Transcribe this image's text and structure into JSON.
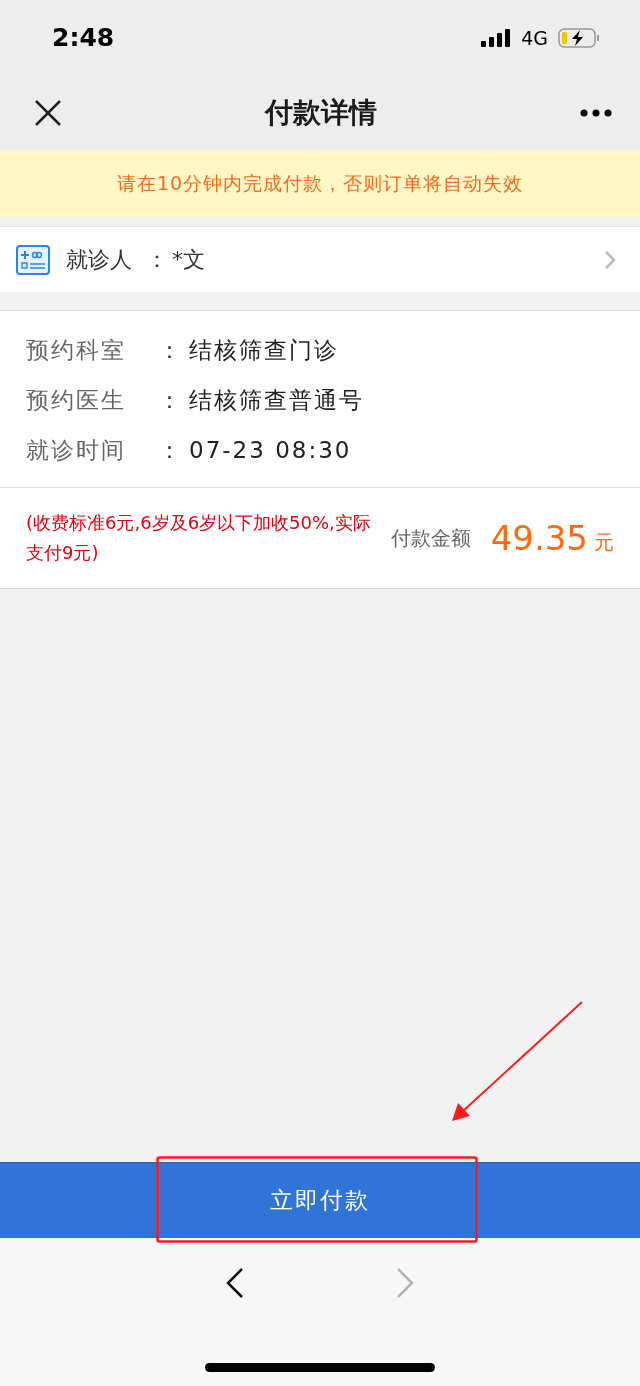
{
  "status_bar": {
    "time": "2:48",
    "network": "4G"
  },
  "nav": {
    "title": "付款详情"
  },
  "notice": "请在10分钟内完成付款，否则订单将自动失效",
  "patient": {
    "label": "就诊人",
    "separator": "：",
    "value": "*文"
  },
  "details": [
    {
      "label": "预约科室",
      "separator": "：",
      "value": "结核筛查门诊"
    },
    {
      "label": "预约医生",
      "separator": "：",
      "value": "结核筛查普通号"
    },
    {
      "label": "就诊时间",
      "separator": "：",
      "value": "07-23 08:30"
    }
  ],
  "fee": {
    "note": "(收费标准6元,6岁及6岁以下加收50%,实际支付9元)",
    "amount_label": "付款金额",
    "amount": "49.35",
    "unit": "元"
  },
  "pay_button": "立即付款",
  "browser_nav": [
    {
      "kind": "back",
      "disabled": false
    },
    {
      "kind": "forward",
      "disabled": true
    }
  ]
}
